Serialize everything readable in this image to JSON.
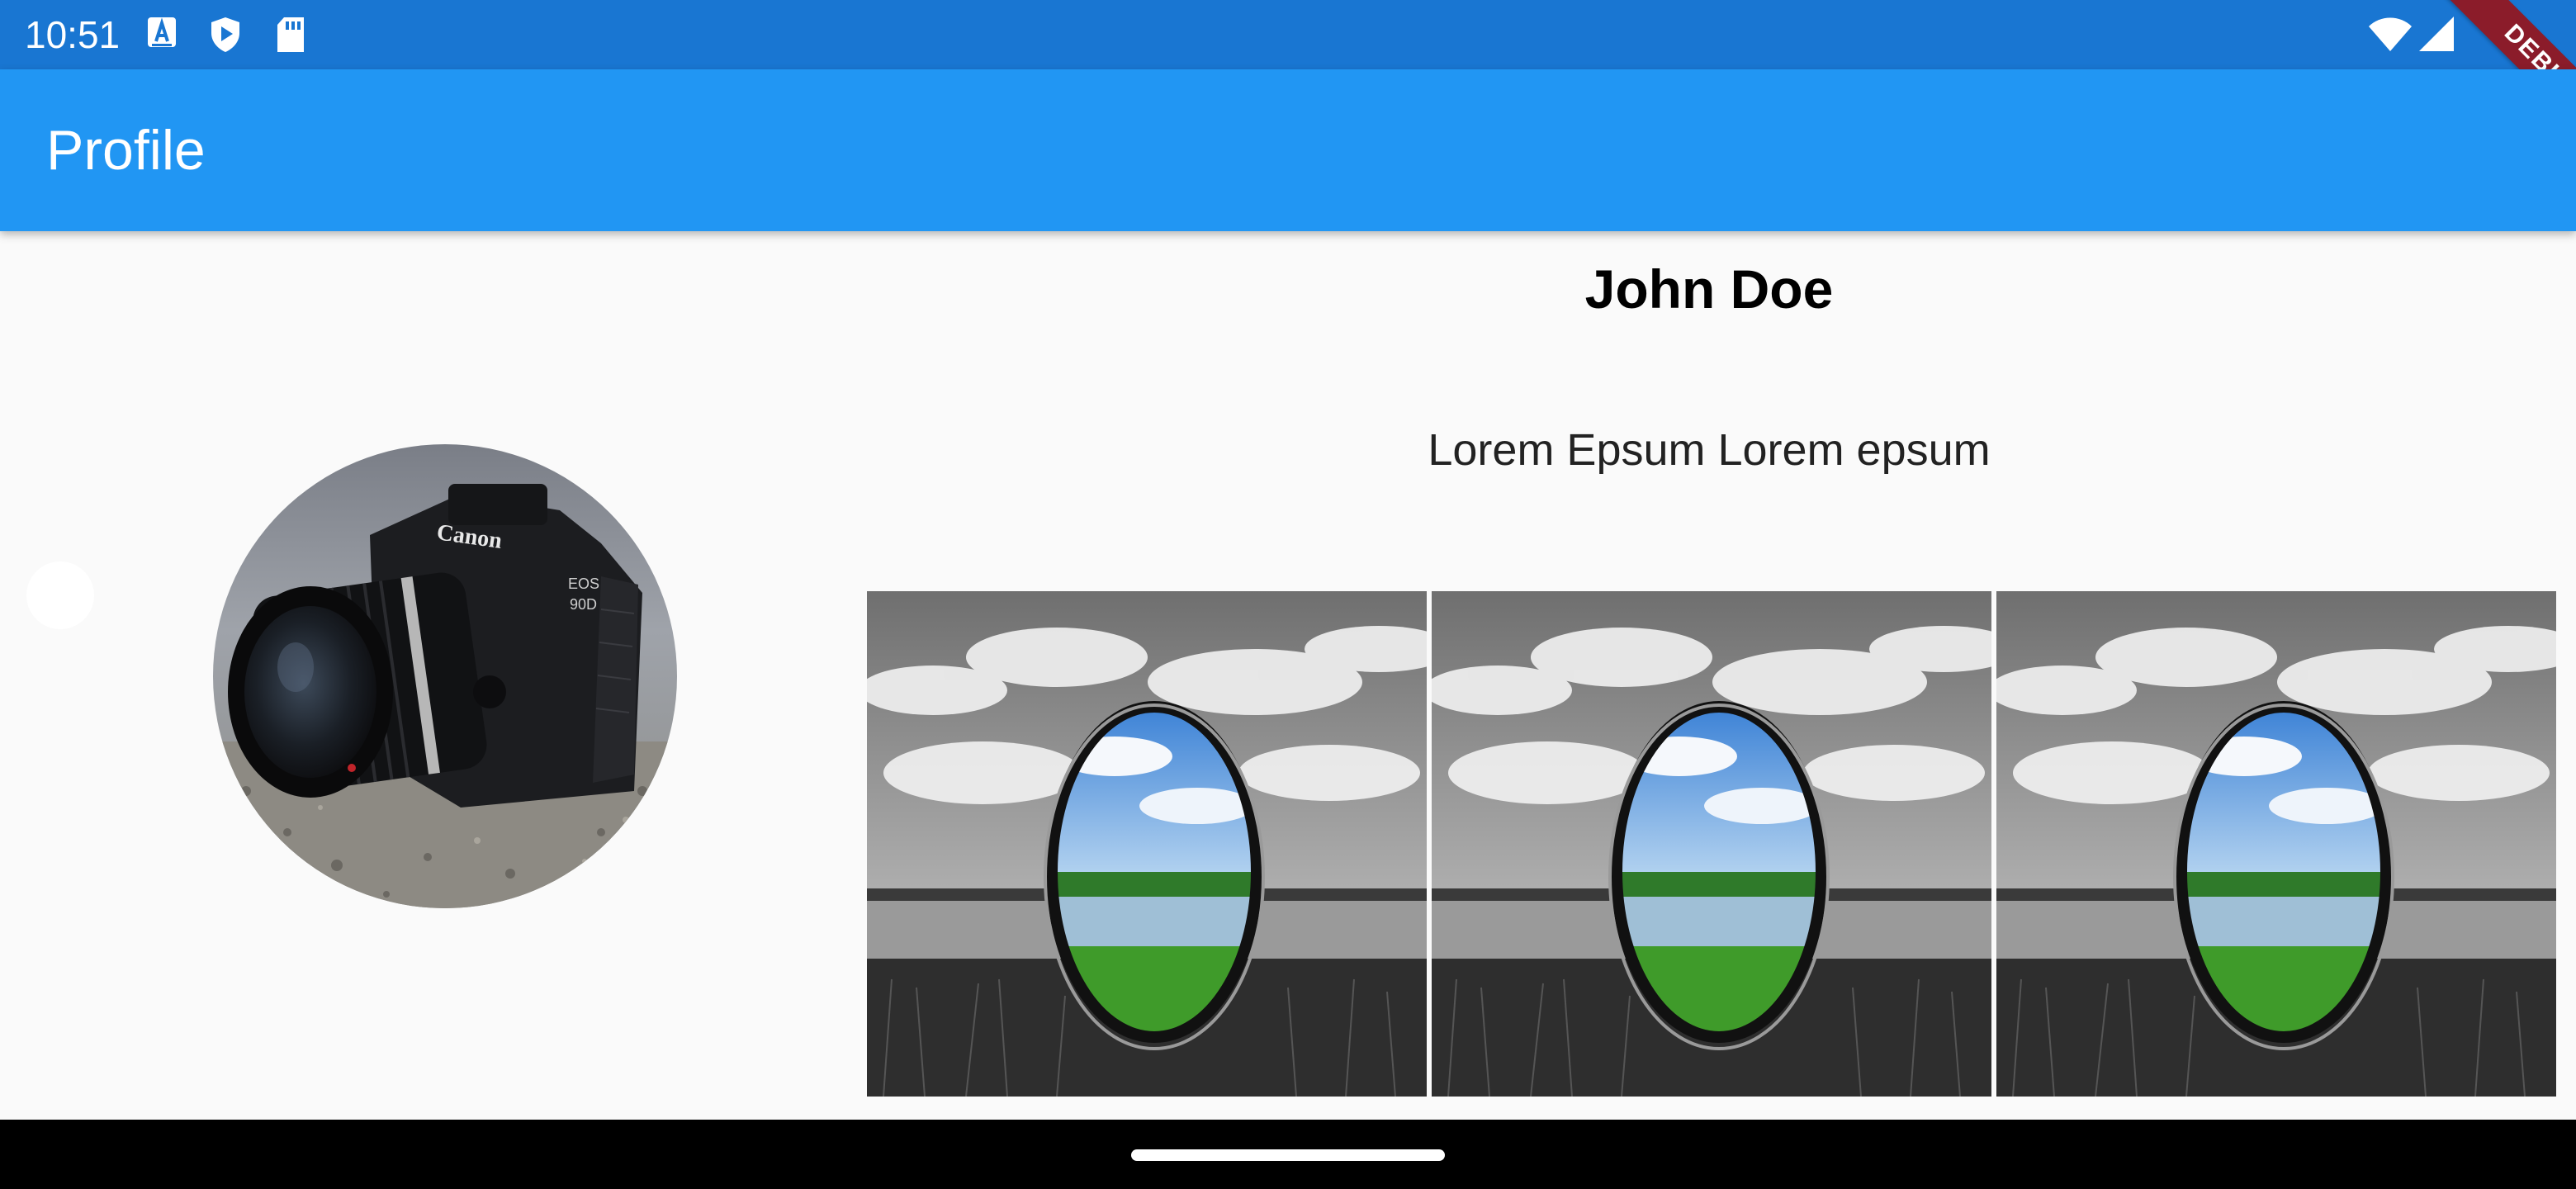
{
  "status_bar": {
    "time": "10:51",
    "icons": [
      "a-notification-icon",
      "play-protect-icon",
      "sd-card-icon",
      "wifi-icon",
      "signal-icon"
    ]
  },
  "debug_banner": {
    "label": "DEBUG"
  },
  "app_bar": {
    "title": "Profile"
  },
  "profile": {
    "name": "John Doe",
    "bio": "Lorem Epsum Lorem epsum",
    "avatar": "camera-photo"
  },
  "gallery": {
    "items": [
      "lens-landscape-photo",
      "lens-landscape-photo",
      "lens-landscape-photo"
    ]
  },
  "colors": {
    "status_bar": "#1976d2",
    "app_bar": "#2196f3",
    "background": "#fafafa",
    "debug": "#8b1c2a"
  }
}
